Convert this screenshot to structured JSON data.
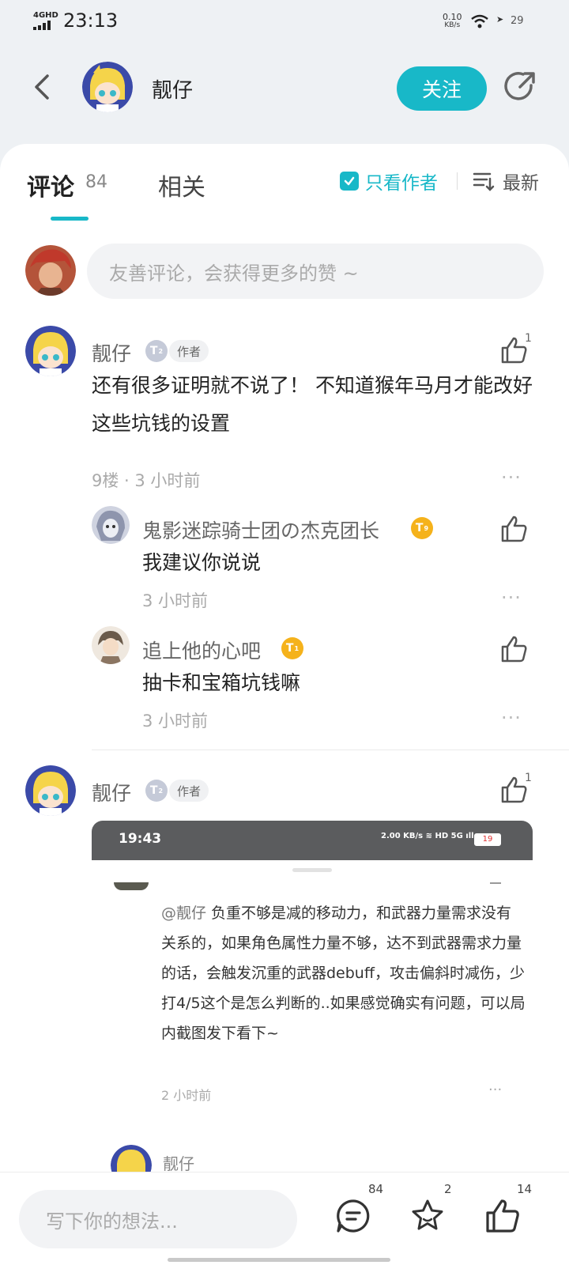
{
  "status_bar": {
    "network": "4GHD",
    "time": "23:13",
    "speed_value": "0.10",
    "speed_unit": "KB/s",
    "battery": "29"
  },
  "header": {
    "username": "靓仔",
    "follow_label": "关注"
  },
  "tabs": {
    "comments_label": "评论",
    "comments_count": "84",
    "related_label": "相关",
    "only_author_label": "只看作者",
    "sort_label": "最新"
  },
  "compose": {
    "placeholder": "友善评论，会获得更多的赞 ~"
  },
  "comments": [
    {
      "name": "靓仔",
      "level": "T",
      "level_sub": "2",
      "author_badge": "作者",
      "likes": "1",
      "text": "还有很多证明就不说了！        不知道猴年马月才能改好这些坑钱的设置",
      "meta": "9楼 · 3 小时前",
      "more": "···",
      "replies": [
        {
          "name": "鬼影迷踪骑士团の杰克团长",
          "level": "T",
          "level_sub": "9",
          "text": "我建议你说说",
          "meta": "3 小时前",
          "more": "···"
        },
        {
          "name": "追上他的心吧",
          "level": "T",
          "level_sub": "1",
          "text": "抽卡和宝箱坑钱嘛",
          "meta": "3 小时前",
          "more": "···"
        }
      ]
    },
    {
      "name": "靓仔",
      "level": "T",
      "level_sub": "2",
      "author_badge": "作者",
      "likes": "1",
      "screenshot": {
        "time": "19:43",
        "status": "2.00 KB/s ≋ HD 5G ıll",
        "battery": "19",
        "mention": "@靓仔",
        "text": " 负重不够是减的移动力，和武器力量需求没有关系的，如果角色属性力量不够，达不到武器需求力量的话，会触发沉重的武器debuff，攻击偏斜时减伤，少打4/5这个是怎么判断的..如果感觉确实有问题，可以局内截图发下看下~",
        "meta": "2 小时前",
        "more": "···"
      },
      "next_preview_name": "靓仔"
    }
  ],
  "bottom_bar": {
    "placeholder": "写下你的想法...",
    "comment_count": "84",
    "favorite_count": "2",
    "like_count": "14"
  },
  "colors": {
    "accent": "#18b8c8",
    "level_gray": "#c5cad8",
    "level_gold": "#f5b21b"
  }
}
